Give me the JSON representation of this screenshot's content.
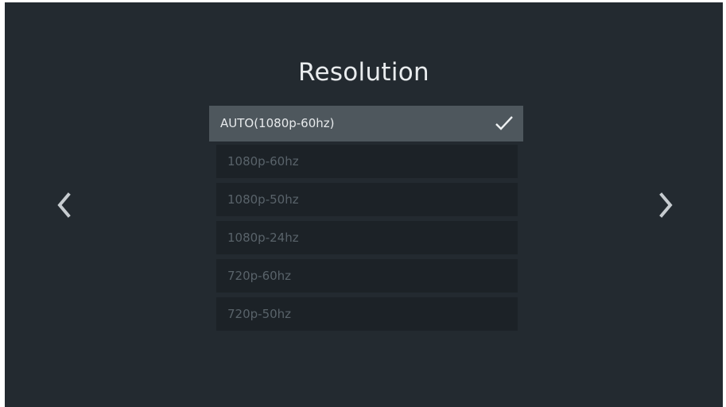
{
  "screen": {
    "title": "Resolution",
    "options": [
      {
        "label": "AUTO(1080p-60hz)",
        "selected": true
      },
      {
        "label": "1080p-60hz",
        "selected": false
      },
      {
        "label": "1080p-50hz",
        "selected": false
      },
      {
        "label": "1080p-24hz",
        "selected": false
      },
      {
        "label": "720p-60hz",
        "selected": false
      },
      {
        "label": "720p-50hz",
        "selected": false
      }
    ],
    "icons": {
      "left": "chevron-left-icon",
      "right": "chevron-right-icon",
      "check": "checkmark-icon"
    },
    "colors": {
      "background": "#232a30",
      "selected_row": "#4e575d",
      "unselected_row": "#1c2227",
      "selected_text": "#e7eaec",
      "unselected_text": "#59636a"
    }
  }
}
